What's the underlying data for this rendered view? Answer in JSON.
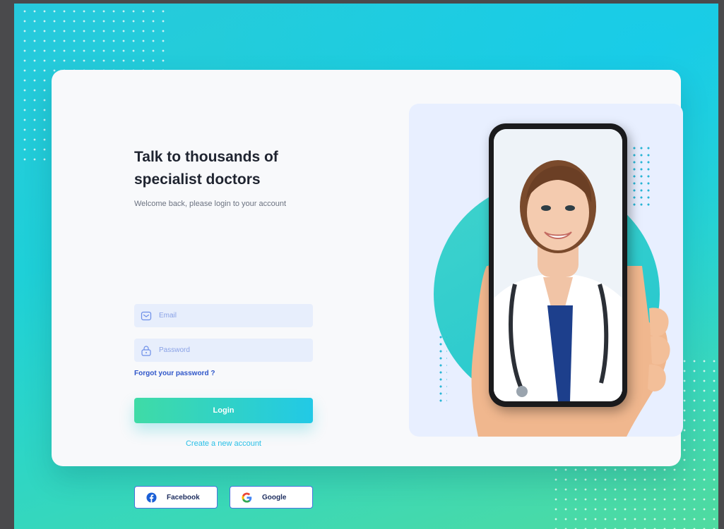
{
  "heading": "Talk to thousands of specialist doctors",
  "subtitle": "Welcome back, please login to your account",
  "email": {
    "placeholder": "Email",
    "icon": "mail-icon"
  },
  "password": {
    "placeholder": "Password",
    "icon": "lock-icon"
  },
  "forgot_label": "Forgot your password ?",
  "login_label": "Login",
  "create_account_label": "Create a new account",
  "social": {
    "facebook_label": "Facebook",
    "google_label": "Google"
  },
  "colors": {
    "accent_start": "#3fdba6",
    "accent_end": "#22c9e6",
    "link": "#2f56c9",
    "field_bg": "#e7eefc"
  }
}
